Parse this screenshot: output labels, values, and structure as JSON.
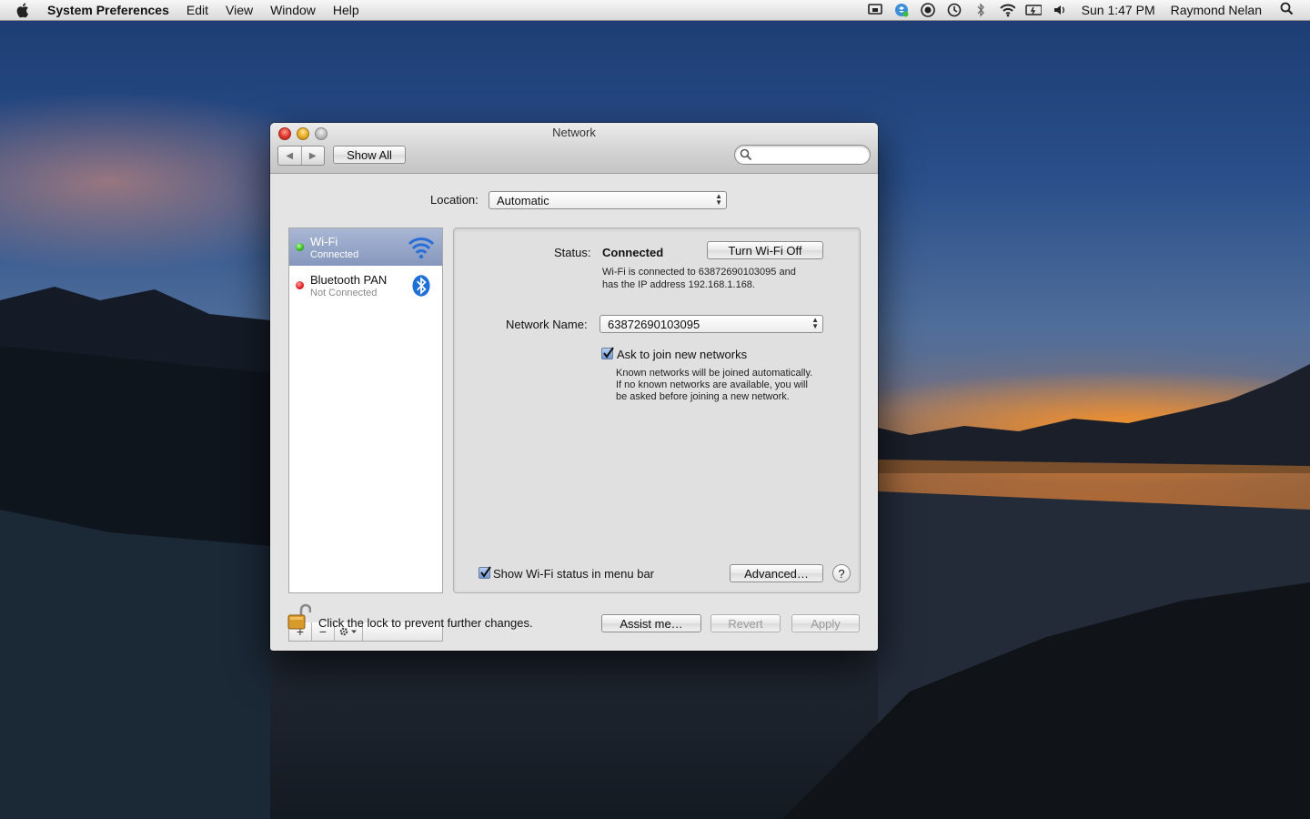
{
  "menubar": {
    "app_name": "System Preferences",
    "items": [
      "Edit",
      "View",
      "Window",
      "Help"
    ],
    "clock": "Sun 1:47 PM",
    "user": "Raymond Nelan",
    "status_icons": [
      "screen-mirroring-icon",
      "dropbox-icon",
      "record-icon",
      "time-machine-icon",
      "bluetooth-icon",
      "wifi-icon",
      "battery-icon",
      "volume-icon"
    ]
  },
  "window": {
    "title": "Network",
    "show_all_label": "Show All",
    "search_placeholder": ""
  },
  "location": {
    "label": "Location:",
    "value": "Automatic"
  },
  "services": [
    {
      "name": "Wi-Fi",
      "status": "Connected",
      "status_color": "#2fb417",
      "icon": "wifi-icon",
      "selected": true
    },
    {
      "name": "Bluetooth PAN",
      "status": "Not Connected",
      "status_color": "#e01b1b",
      "icon": "bluetooth-icon",
      "selected": false
    }
  ],
  "list_toolbar": {
    "add": "+",
    "remove": "−"
  },
  "detail": {
    "status_label": "Status:",
    "status_value": "Connected",
    "toggle_button": "Turn Wi-Fi Off",
    "status_desc_1": "Wi-Fi is connected to 63872690103095 and",
    "status_desc_2": "has the IP address 192.168.1.168.",
    "network_name_label": "Network Name:",
    "network_name_value": "63872690103095",
    "ask_join_label": "Ask to join new networks",
    "ask_join_checked": true,
    "ask_join_desc_1": "Known networks will be joined automatically.",
    "ask_join_desc_2": "If no known networks are available, you will",
    "ask_join_desc_3": "be asked before joining a new network.",
    "show_status_label": "Show Wi-Fi status in menu bar",
    "show_status_checked": true,
    "advanced_button": "Advanced…",
    "help_label": "?"
  },
  "footer": {
    "lock_text": "Click the lock to prevent further changes.",
    "assist_button": "Assist me…",
    "revert_button": "Revert",
    "apply_button": "Apply"
  },
  "colors": {
    "selection": "#8597bd",
    "wifi_blue": "#2a6fd6",
    "bluetooth_blue": "#1f6fd9"
  }
}
